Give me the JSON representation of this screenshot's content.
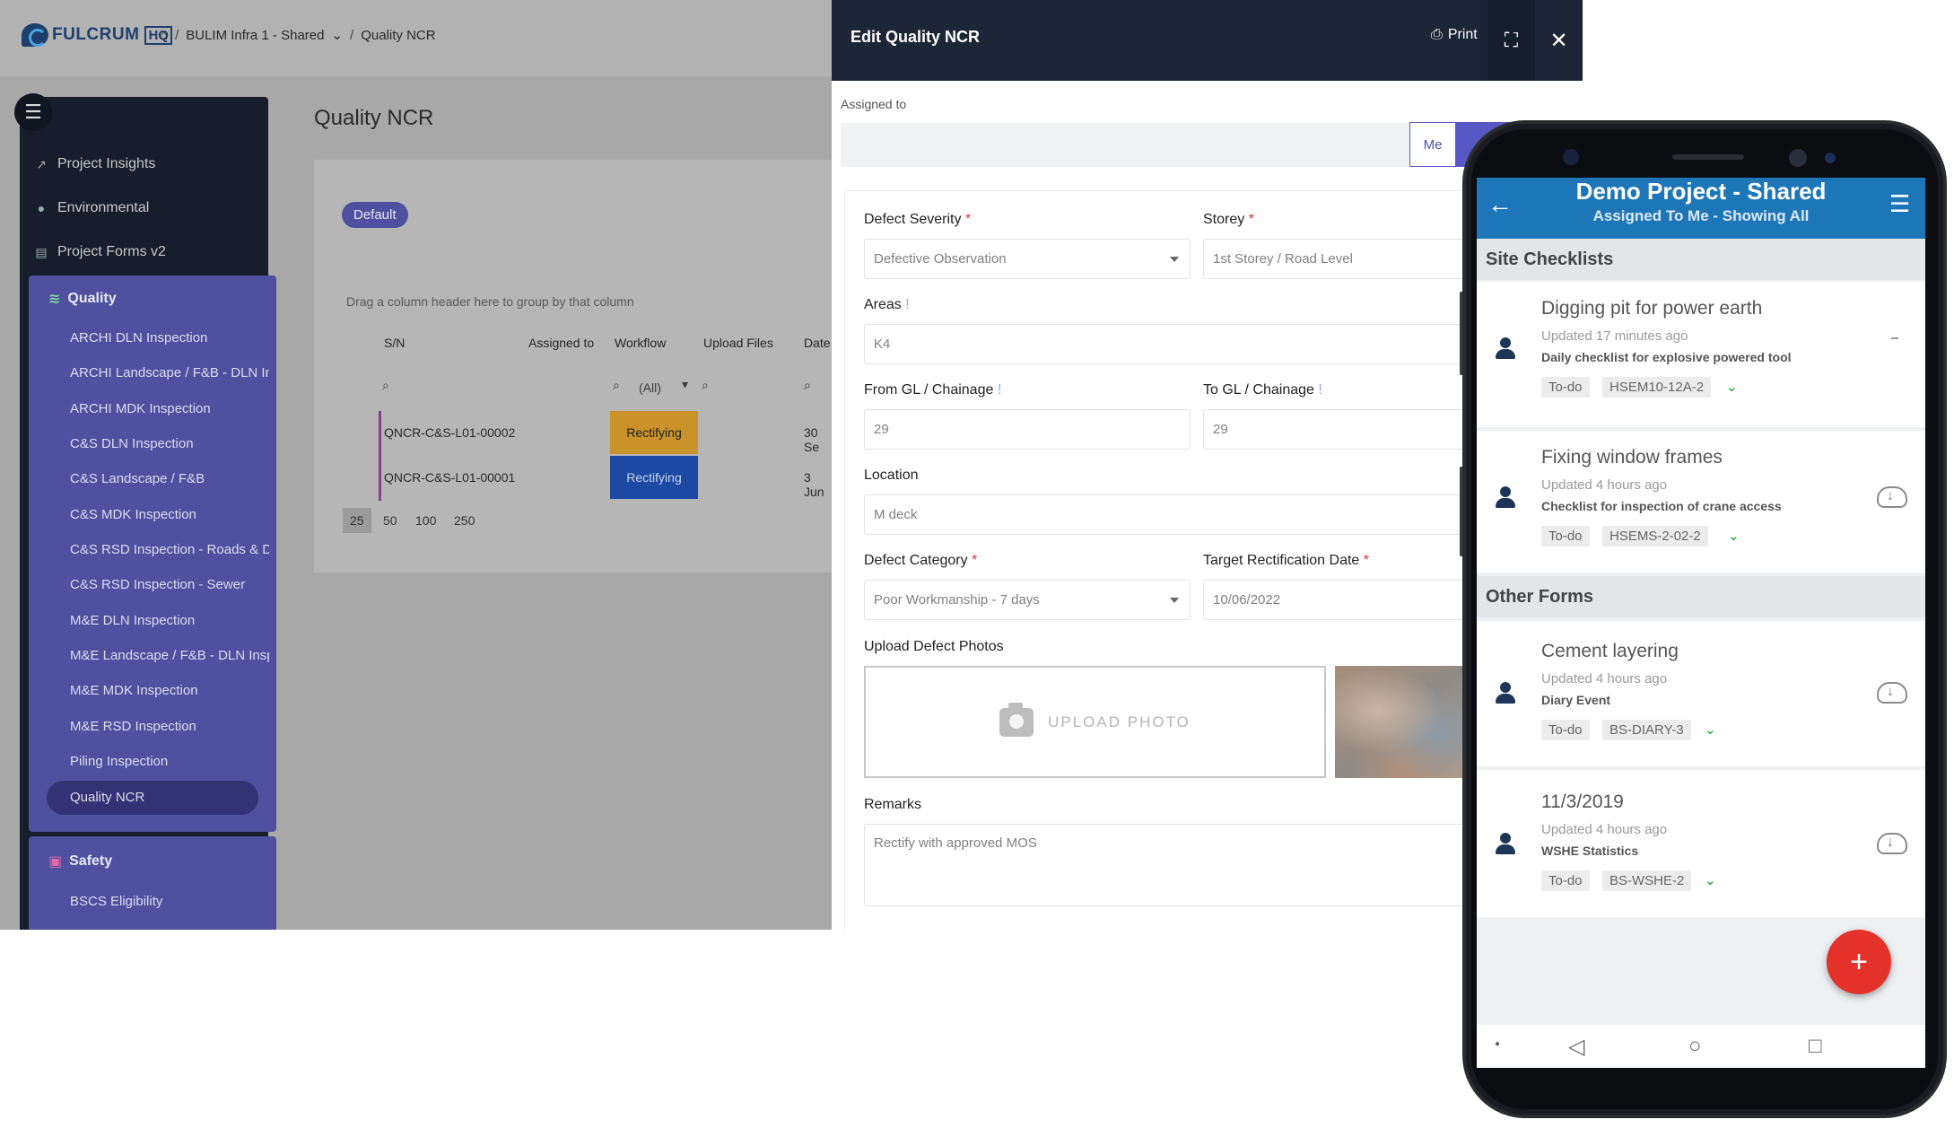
{
  "brand": {
    "name": "FULCRUM",
    "suffix": "HQ"
  },
  "breadcrumb": {
    "project": "BULIM Infra 1 - Shared",
    "page": "Quality NCR"
  },
  "sidebar": {
    "items": [
      {
        "label": "Project Insights",
        "icon": "chart-icon"
      },
      {
        "label": "Environmental",
        "icon": "pin-icon"
      },
      {
        "label": "Project Forms v2",
        "icon": "clipboard-icon"
      }
    ],
    "quality": {
      "label": "Quality",
      "items": [
        "ARCHI DLN Inspection",
        "ARCHI Landscape / F&B - DLN Insp",
        "ARCHI MDK Inspection",
        "C&S DLN Inspection",
        "C&S Landscape / F&B",
        "C&S MDK Inspection",
        "C&S RSD Inspection - Roads & Dr",
        "C&S RSD Inspection - Sewer",
        "M&E DLN Inspection",
        "M&E Landscape / F&B - DLN Inspe",
        "M&E MDK Inspection",
        "M&E RSD Inspection",
        "Piling Inspection",
        "Quality NCR"
      ]
    },
    "safety": {
      "label": "Safety",
      "items": [
        "BSCS Eligibility"
      ]
    }
  },
  "main": {
    "title": "Quality NCR",
    "view": "Default",
    "drag_hint": "Drag a column header here to group by that column",
    "columns": [
      "S/N",
      "Assigned to",
      "Workflow",
      "Upload Files",
      "Date"
    ],
    "workflow_filter": "(All)",
    "rows": [
      {
        "sn": "QNCR-C&S-L01-00002",
        "workflow": "Rectifying",
        "date": "30 Se",
        "color": "#c9932a"
      },
      {
        "sn": "QNCR-C&S-L01-00001",
        "workflow": "Rectifying",
        "date": "3 Jun",
        "color": "#1c4aa3"
      }
    ],
    "page_sizes": [
      "25",
      "50",
      "100",
      "250"
    ]
  },
  "modal": {
    "title": "Edit Quality NCR",
    "print": "Print",
    "assigned_to_label": "Assigned to",
    "me_label": "Me",
    "fields": {
      "defect_severity": {
        "label": "Defect Severity",
        "value": "Defective Observation"
      },
      "storey": {
        "label": "Storey",
        "value": "1st Storey / Road Level"
      },
      "areas": {
        "label": "Areas",
        "value": "K4"
      },
      "from_gl": {
        "label": "From GL / Chainage",
        "value": "29"
      },
      "to_gl": {
        "label": "To GL / Chainage",
        "value": "29"
      },
      "location": {
        "label": "Location",
        "value": "M deck"
      },
      "defect_category": {
        "label": "Defect Category",
        "value": "Poor Workmanship - 7 days"
      },
      "target_date": {
        "label": "Target Rectification Date",
        "value": "10/06/2022"
      },
      "upload_label": "Upload Defect Photos",
      "upload_button": "UPLOAD PHOTO",
      "remarks": {
        "label": "Remarks",
        "value": "Rectify with approved MOS"
      }
    }
  },
  "phone": {
    "title": "Demo Project - Shared",
    "subtitle": "Assigned To Me  - Showing All",
    "site_checklists": "Site Checklists",
    "other_forms": "Other Forms",
    "cards": [
      {
        "title": "Digging pit for power earth",
        "updated": "Updated 17 minutes ago",
        "desc": "Daily checklist for explosive powered tool",
        "status": "To-do",
        "code": "HSEM10-12A-2"
      },
      {
        "title": "Fixing window frames",
        "updated": "Updated 4 hours ago",
        "desc": "Checklist for inspection of crane access",
        "status": "To-do",
        "code": "HSEMS-2-02-2"
      },
      {
        "title": "Cement layering",
        "updated": "Updated 4 hours ago",
        "desc": "Diary Event",
        "status": "To-do",
        "code": "BS-DIARY-3"
      },
      {
        "title": "11/3/2019",
        "updated": "Updated 4 hours ago",
        "desc": "WSHE Statistics",
        "status": "To-do",
        "code": "BS-WSHE-2"
      }
    ],
    "fab": "+"
  }
}
